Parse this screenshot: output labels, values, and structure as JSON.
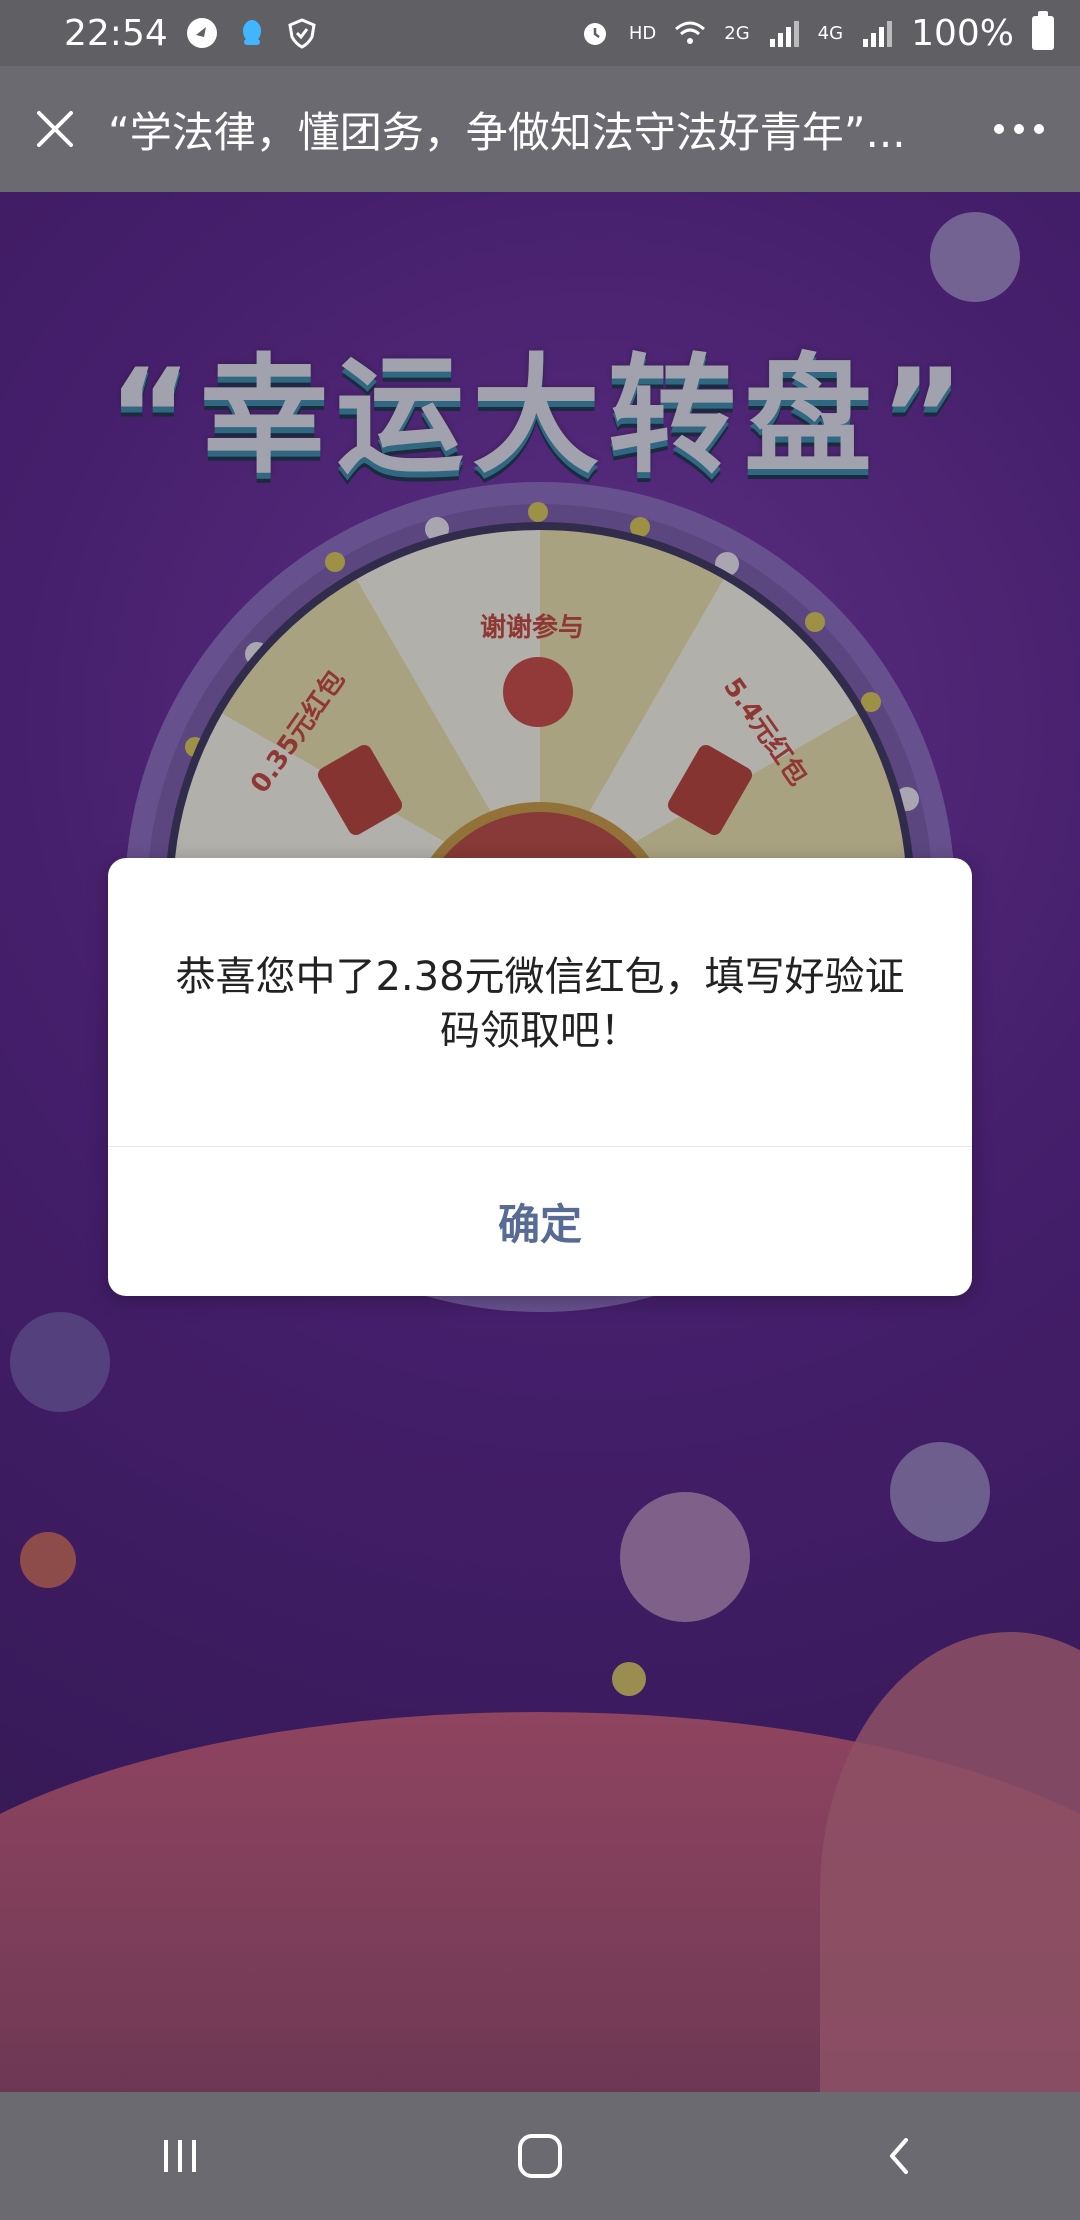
{
  "status_bar": {
    "time": "22:54",
    "hd": "HD",
    "net_2g": "2G",
    "net_4g": "4G",
    "battery_percent": "100%",
    "icons": [
      "bird-notification-icon",
      "qq-icon",
      "shield-icon",
      "alarm-icon",
      "wifi-icon",
      "signal-icon",
      "battery-icon"
    ]
  },
  "nav_bar": {
    "title": "“学法律，懂团务，争做知法守法好青年”...",
    "close_icon": "close-icon",
    "more_icon": "more-icon"
  },
  "page": {
    "banner": "“幸运大转盘”",
    "prizes": [
      "谢谢参与",
      "0.35元红包",
      "5.4元红包"
    ]
  },
  "dialog": {
    "message": "恭喜您中了2.38元微信红包，填写好验证码领取吧！",
    "confirm_label": "确定",
    "confirm_color": "#576b95"
  },
  "system_nav": {
    "icons": [
      "recents-icon",
      "home-icon",
      "back-icon"
    ]
  },
  "colors": {
    "status_bg": "#5f5f64",
    "nav_bg": "#6a6a70",
    "page_bg": "#4a1380",
    "accent_red": "#b3352f"
  }
}
